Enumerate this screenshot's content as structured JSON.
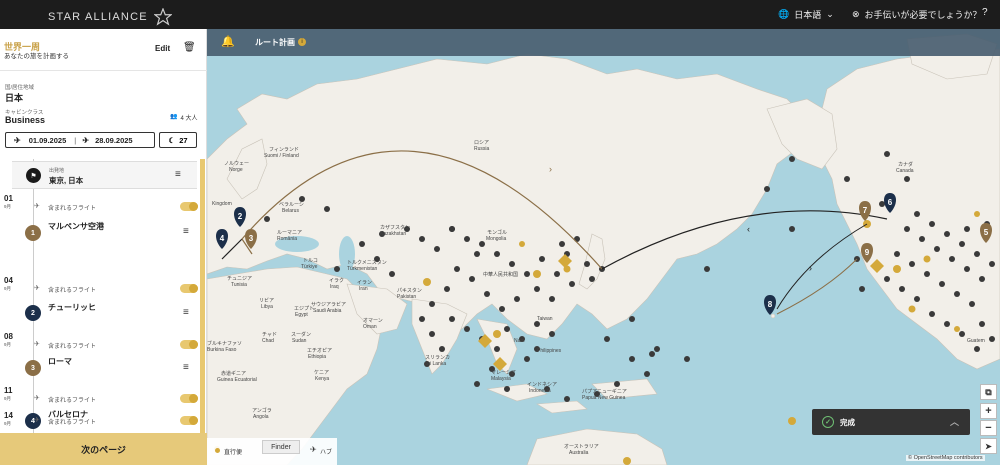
{
  "header": {
    "logo_text": "STAR ALLIANCE",
    "language": "日本語",
    "help": "お手伝いが必要でしょうか？",
    "help_icon": "?"
  },
  "sidebar": {
    "title": "世界一周",
    "subtitle": "あなたの旅を計画する",
    "edit_label": "Edit",
    "country_label": "国/居住地域",
    "country_value": "日本",
    "cabin_label": "キャビンクラス",
    "cabin_value": "Business",
    "pax": "4 大人",
    "date_start": "01.09.2025",
    "date_end": "28.09.2025",
    "nights": "27",
    "origin_label": "出発地",
    "origin_value": "東京, 日本",
    "flight_text": "含まれるフライト",
    "flights": [
      {
        "day": "01",
        "month": "9月"
      },
      {
        "day": "04",
        "month": "9月"
      },
      {
        "day": "08",
        "month": "9月"
      },
      {
        "day": "11",
        "month": "9月"
      },
      {
        "day": "14",
        "month": "9月"
      }
    ],
    "stops": [
      {
        "num": "1",
        "name": "マルペンサ空港",
        "color": "#8b6f47"
      },
      {
        "num": "2",
        "name": "チューリッヒ",
        "color": "#1c2f4a"
      },
      {
        "num": "3",
        "name": "ローマ",
        "color": "#8b6f47"
      },
      {
        "num": "4",
        "name": "バルセロナ",
        "color": "#1c2f4a"
      }
    ],
    "next_button": "次のページ"
  },
  "map": {
    "title": "ルート計画",
    "info": "i",
    "complete_label": "完成",
    "legend_label": "直行便",
    "finder_label": "Finder",
    "hub_label": "ハブ",
    "attribution": "© OpenStreetMap contributors",
    "labels": {
      "russia": "ロシア",
      "russia_en": "Russia",
      "finland": "フィンランド",
      "finland_en": "Suomi / Finland",
      "norway": "ノルウェー",
      "norway_en": "Norge",
      "belarus": "ベラルーシ",
      "belarus_en": "Belarus",
      "romania": "ルーマニア",
      "romania_en": "România",
      "turkey": "トルコ",
      "turkey_en": "Türkiye",
      "tunisia": "チュニジア",
      "tunisia_en": "Tunisia",
      "libya": "リビア",
      "libya_en": "Libya",
      "egypt": "エジプト",
      "egypt_en": "Egypt",
      "chad": "チャド",
      "chad_en": "Chad",
      "sudan": "スーダン",
      "sudan_en": "Sudan",
      "ethiopia": "エチオピア",
      "ethiopia_en": "Ethiopia",
      "kenya": "ケニア",
      "kenya_en": "Kenya",
      "angola": "アンゴラ",
      "angola_en": "Angola",
      "burkina": "ブルキナファソ",
      "burkina_en": "Burkina Faso",
      "eqguinea": "赤道ギニア",
      "eqguinea_en": "Guinea Ecuatorial",
      "iraq": "イラク",
      "iraq_en": "Iraq",
      "iran": "イラン",
      "iran_en": "Iran",
      "saudi": "サウジアラビア",
      "saudi_en": "Saudi Arabia",
      "oman": "オマーン",
      "oman_en": "Oman",
      "kazakhstan": "カザフスタン",
      "kazakhstan_en": "Kazakhstan",
      "turkmenistan": "トルクメニスタン",
      "turkmenistan_en": "Türkmenistan",
      "pakistan": "パキスタン",
      "pakistan_en": "Pakistan",
      "mongolia": "モンゴル",
      "mongolia_en": "Mongolia",
      "china": "中華人民共和国",
      "srilanka": "スリランカ",
      "srilanka_en": "Sri Lanka",
      "malaysia": "マレーシア",
      "malaysia_en": "Malaysia",
      "indonesia": "インドネシア",
      "indonesia_en": "Indonesia",
      "png": "パプアニューギニア",
      "png_en": "Papua New Guinea",
      "australia": "オーストラリア",
      "australia_en": "Australia",
      "taiwan": "Taiwan",
      "philippines": "Philippines",
      "vietnam": "Nam",
      "canada": "カナダ",
      "canada_en": "Canada",
      "guatemala": "Guatem",
      "kingdom": "Kingdom"
    },
    "pins": [
      {
        "num": "2",
        "color": "#1c2f4a"
      },
      {
        "num": "3",
        "color": "#8b6f47"
      },
      {
        "num": "4",
        "color": "#1c2f4a"
      },
      {
        "num": "5",
        "color": "#8b6f47"
      },
      {
        "num": "6",
        "color": "#1c2f4a"
      },
      {
        "num": "7",
        "color": "#8b6f47"
      },
      {
        "num": "8",
        "color": "#1c2f4a"
      },
      {
        "num": "9",
        "color": "#8b6f47"
      }
    ]
  }
}
